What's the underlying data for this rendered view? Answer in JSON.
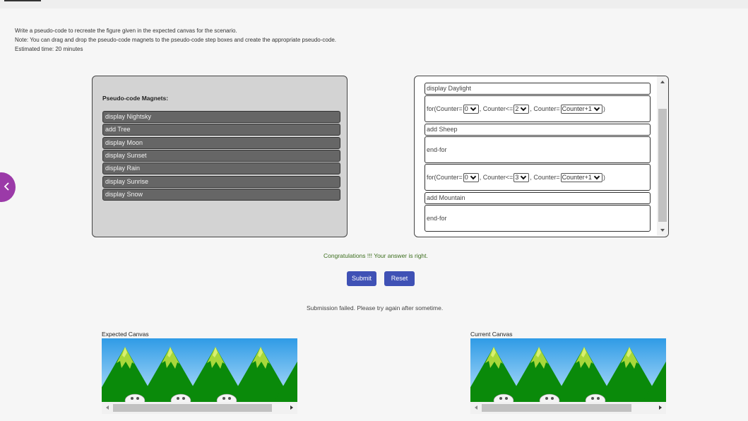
{
  "instructions": {
    "line1": "Write a pseudo-code to recreate the figure given in the expected canvas for the scenario.",
    "line2": "Note: You can drag and drop the pseudo-code magnets to the pseudo-code step boxes and create the appropriate pseudo-code.",
    "line3": "Estimated time: 20 minutes"
  },
  "magnets": {
    "title": "Pseudo-code Magnets:",
    "items": [
      "display Nightsky",
      "add Tree",
      "display Moon",
      "display Sunset",
      "display Rain",
      "display Sunrise",
      "display Snow"
    ]
  },
  "steps": {
    "s1": "display Daylight",
    "for1": {
      "prefix": "for(Counter=",
      "start": "0",
      "mid": ", Counter<=",
      "end": "2",
      "mid2": ", Counter=",
      "incr": "Counter+1",
      "close": ")"
    },
    "s2": "add Sheep",
    "s3": "end-for",
    "for2": {
      "prefix": "for(Counter=",
      "start": "0",
      "mid": ", Counter<=",
      "end": "3",
      "mid2": ", Counter=",
      "incr": "Counter+1",
      "close": ")"
    },
    "s4": "add Mountain",
    "s5": "end-for"
  },
  "messages": {
    "success": "Congratulations !!! Your answer is right.",
    "failure": "Submission failed. Please try again after sometime."
  },
  "buttons": {
    "submit": "Submit",
    "reset": "Reset"
  },
  "canvases": {
    "expected_label": "Expected Canvas",
    "current_label": "Current Canvas"
  },
  "colors": {
    "accent": "#3f51b5",
    "close_button": "#9b3aa8",
    "magnet": "#666666",
    "sky": "#3aa7e8",
    "mountain": "#0a8a0a",
    "peak": "#a8d83a"
  }
}
